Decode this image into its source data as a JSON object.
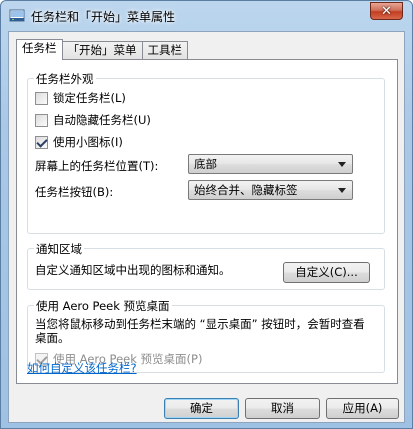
{
  "window": {
    "title": "任务栏和「开始」菜单属性",
    "close_glyph": "✕",
    "title_icon": "taskbar-properties-icon"
  },
  "tabs": [
    {
      "label": "任务栏",
      "active": true
    },
    {
      "label": "「开始」菜单",
      "active": false
    },
    {
      "label": "工具栏",
      "active": false
    }
  ],
  "appearance": {
    "title": "任务栏外观",
    "lock_label": "锁定任务栏(L)",
    "lock_checked": false,
    "autohide_label": "自动隐藏任务栏(U)",
    "autohide_checked": false,
    "small_icons_label": "使用小图标(I)",
    "small_icons_checked": true,
    "position_label": "屏幕上的任务栏位置(T):",
    "position_value": "底部",
    "buttons_label": "任务栏按钮(B):",
    "buttons_value": "始终合并、隐藏标签"
  },
  "notify": {
    "title": "通知区域",
    "desc": "自定义通知区域中出现的图标和通知。",
    "customize_button": "自定义(C)..."
  },
  "aero": {
    "title": "使用 Aero Peek 预览桌面",
    "desc": "当您将鼠标移动到任务栏末端的 “显示桌面” 按钮时，会暂时查看桌面。",
    "checkbox_label": "使用 Aero Peek 预览桌面(P)",
    "checkbox_checked": true,
    "checkbox_disabled": true
  },
  "help_link": "如何自定义该任务栏?",
  "footer": {
    "ok": "确定",
    "cancel": "取消",
    "apply": "应用(A)"
  }
}
